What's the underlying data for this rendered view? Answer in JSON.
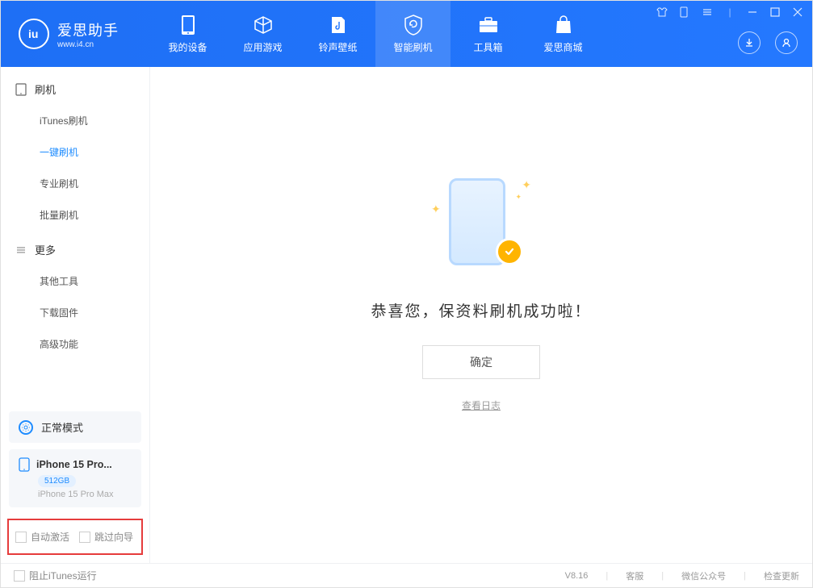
{
  "app": {
    "name": "爱思助手",
    "url": "www.i4.cn",
    "version": "V8.16"
  },
  "nav": {
    "items": [
      {
        "label": "我的设备"
      },
      {
        "label": "应用游戏"
      },
      {
        "label": "铃声壁纸"
      },
      {
        "label": "智能刷机"
      },
      {
        "label": "工具箱"
      },
      {
        "label": "爱思商城"
      }
    ]
  },
  "sidebar": {
    "group1": {
      "label": "刷机"
    },
    "items1": [
      {
        "label": "iTunes刷机"
      },
      {
        "label": "一键刷机"
      },
      {
        "label": "专业刷机"
      },
      {
        "label": "批量刷机"
      }
    ],
    "group2": {
      "label": "更多"
    },
    "items2": [
      {
        "label": "其他工具"
      },
      {
        "label": "下载固件"
      },
      {
        "label": "高级功能"
      }
    ],
    "mode": "正常模式",
    "device": {
      "name": "iPhone 15 Pro...",
      "storage": "512GB",
      "model": "iPhone 15 Pro Max"
    },
    "options": {
      "auto_activate": "自动激活",
      "skip_guide": "跳过向导"
    }
  },
  "main": {
    "success_title": "恭喜您，保资料刷机成功啦！",
    "ok_button": "确定",
    "log_link": "查看日志"
  },
  "footer": {
    "block_itunes": "阻止iTunes运行",
    "support": "客服",
    "wechat": "微信公众号",
    "check_update": "检查更新"
  }
}
